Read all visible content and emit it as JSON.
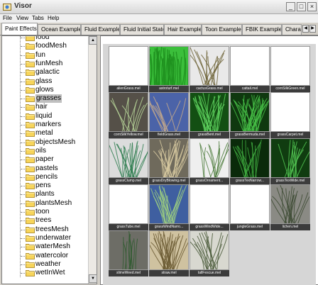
{
  "window": {
    "title": "Visor",
    "buttons": [
      "_",
      "□",
      "×"
    ]
  },
  "menubar": [
    "File",
    "View",
    "Tabs",
    "Help"
  ],
  "tabs": [
    "Paint Effects",
    "Ocean Examples",
    "Fluid Examples",
    "Fluid Initial States",
    "Hair Examples",
    "Toon Examples",
    "FBIK Examples",
    "Chara"
  ],
  "tab_scroll": {
    "left": "◀",
    "right": "▶"
  },
  "tree": {
    "items": [
      "food",
      "foodMesh",
      "fun",
      "funMesh",
      "galactic",
      "glass",
      "glows",
      "grasses",
      "hair",
      "liquid",
      "markers",
      "metal",
      "objectsMesh",
      "oils",
      "paper",
      "pastels",
      "pencils",
      "pens",
      "plants",
      "plantsMesh",
      "toon",
      "trees",
      "treesMesh",
      "underwater",
      "waterMesh",
      "watercolor",
      "weather",
      "wetInWet"
    ],
    "selected": "grasses"
  },
  "scroll_arrows": {
    "up": "▲",
    "down": "▼"
  },
  "thumbnails": [
    {
      "label": "alienGrass.mel",
      "kind": "blank"
    },
    {
      "label": "astroturf.mel",
      "kind": "astroturf"
    },
    {
      "label": "cactusGrass.mel",
      "kind": "cactus"
    },
    {
      "label": "cattail.mel",
      "kind": "blank"
    },
    {
      "label": "cornSilkGreen.mel",
      "kind": "blank"
    },
    {
      "label": "cornSilkYellow.mel",
      "kind": "darkblades"
    },
    {
      "label": "fieldGrass.mel",
      "kind": "blue"
    },
    {
      "label": "grassBent.mel",
      "kind": "greenbent"
    },
    {
      "label": "grassBermuda.mel",
      "kind": "bermuda"
    },
    {
      "label": "grassCarpet.mel",
      "kind": "blank"
    },
    {
      "label": "grassClump.mel",
      "kind": "clump"
    },
    {
      "label": "grassDryBlowing.mel",
      "kind": "dry"
    },
    {
      "label": "grassOrnament...",
      "kind": "ornament"
    },
    {
      "label": "grassTexNarrow...",
      "kind": "texnarrow"
    },
    {
      "label": "grassTexWide.mel",
      "kind": "texwide"
    },
    {
      "label": "grassTube.mel",
      "kind": "blank"
    },
    {
      "label": "grassWindNarro...",
      "kind": "windnarrow"
    },
    {
      "label": "grassWindWide...",
      "kind": "blank"
    },
    {
      "label": "jungleGrass.mel",
      "kind": "blank"
    },
    {
      "label": "lichen.mel",
      "kind": "lichen"
    },
    {
      "label": "slimeWeed.mel",
      "kind": "slime"
    },
    {
      "label": "straw.mel",
      "kind": "straw"
    },
    {
      "label": "tallFescue.mel",
      "kind": "fescue"
    }
  ]
}
